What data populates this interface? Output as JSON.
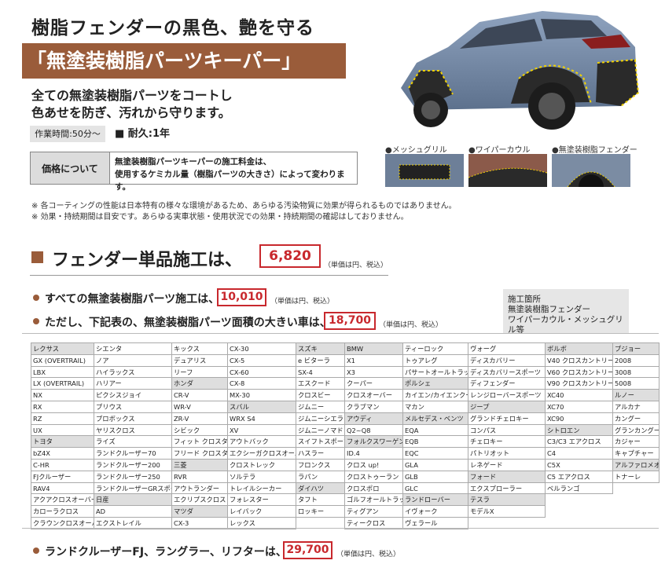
{
  "header": {
    "title1": "樹脂フェンダーの黒色、艶を守る",
    "title2": "「無塗装樹脂パーツキーパー」",
    "desc_line1": "全ての無塗装樹脂パーツをコートし",
    "desc_line2": "色あせを防ぎ、汚れから守ります。",
    "work_time": "作業時間:50分～",
    "durability": "■ 耐久:1年"
  },
  "price_info": {
    "label": "価格について",
    "line1": "無塗装樹脂パーツキーパーの施工料金は、",
    "line2": "使用するケミカル量（樹脂パーツの大きさ）によって変わります。"
  },
  "notes": [
    "※ 各コーティングの性能は日本特有の様々な環境があるため、あらゆる汚染物質に効果が得られるものではありません。",
    "※ 効果・持続期間は目安です。あらゆる実車状態・使用状況での効果・持続期間の確認はしておりません。"
  ],
  "photo_labels": {
    "mesh_grill": "●メッシュグリル",
    "wiper_cowl": "●ワイパーカウル",
    "fender": "●無塗装樹脂フェンダー"
  },
  "fender_single": {
    "label": "フェンダー単品施工は、",
    "price": "6,820",
    "unit": "（単価は円、税込）"
  },
  "all_parts": {
    "label": "すべての無塗装樹脂パーツ施工は、",
    "price": "10,010",
    "unit": "（単価は円、税込）"
  },
  "large_cars": {
    "label": "ただし、下記表の、無塗装樹脂パーツ面積の大きい車は、",
    "price": "18,700",
    "unit": "（単価は円、税込）"
  },
  "info_box": {
    "line1": "施工箇所",
    "line2": "無塗装樹脂フェンダー",
    "line3": "ワイパーカウル・メッシュグリル等"
  },
  "car_table": [
    [
      {
        "t": "レクサス",
        "g": true
      },
      {
        "t": "GX (OVERTRAIL)"
      },
      {
        "t": "LBX"
      },
      {
        "t": "LX (OVERTRAIL)"
      },
      {
        "t": "NX"
      },
      {
        "t": "RX"
      },
      {
        "t": "RZ"
      },
      {
        "t": "UX"
      },
      {
        "t": "トヨタ",
        "g": true
      },
      {
        "t": "bZ4X"
      },
      {
        "t": "C-HR"
      },
      {
        "t": "FJクルーザー"
      },
      {
        "t": "RAV4"
      },
      {
        "t": "アクアクロスオーバー"
      },
      {
        "t": "カローラクロス"
      },
      {
        "t": "クラウンクロスオーバー"
      }
    ],
    [
      {
        "t": "シエンタ"
      },
      {
        "t": "ノア"
      },
      {
        "t": "ハイラックス"
      },
      {
        "t": "ハリアー"
      },
      {
        "t": "ピクシスジョイ"
      },
      {
        "t": "プリウス"
      },
      {
        "t": "プロボックス"
      },
      {
        "t": "ヤリスクロス"
      },
      {
        "t": "ライズ"
      },
      {
        "t": "ランドクルーザー70"
      },
      {
        "t": "ランドクルーザー200"
      },
      {
        "t": "ランドクルーザー250"
      },
      {
        "t": "ランドクルーザーGRスポーツ"
      },
      {
        "t": "日産",
        "g": true
      },
      {
        "t": "AD"
      },
      {
        "t": "エクストレイル"
      }
    ],
    [
      {
        "t": "キックス"
      },
      {
        "t": "デュアリス"
      },
      {
        "t": "リーフ"
      },
      {
        "t": "ホンダ",
        "g": true
      },
      {
        "t": "CR-V"
      },
      {
        "t": "WR-V"
      },
      {
        "t": "ZR-V"
      },
      {
        "t": "シビック"
      },
      {
        "t": "フィット クロスター"
      },
      {
        "t": "フリード クロスター"
      },
      {
        "t": "三菱",
        "g": true
      },
      {
        "t": "RVR"
      },
      {
        "t": "アウトランダー"
      },
      {
        "t": "エクリプスクロス"
      },
      {
        "t": "マツダ",
        "g": true
      },
      {
        "t": "CX-3"
      }
    ],
    [
      {
        "t": "CX-30"
      },
      {
        "t": "CX-5"
      },
      {
        "t": "CX-60"
      },
      {
        "t": "CX-8"
      },
      {
        "t": "MX-30"
      },
      {
        "t": "スバル",
        "g": true
      },
      {
        "t": "WRX S4"
      },
      {
        "t": "XV"
      },
      {
        "t": "アウトバック"
      },
      {
        "t": "エクシーガクロスオーバー"
      },
      {
        "t": "クロストレック"
      },
      {
        "t": "ソルテラ"
      },
      {
        "t": "トレイルシーカー"
      },
      {
        "t": "フォレスター"
      },
      {
        "t": "レイバック"
      },
      {
        "t": "レックス"
      }
    ],
    [
      {
        "t": "スズキ",
        "g": true
      },
      {
        "t": "e ビターラ"
      },
      {
        "t": "SX-4"
      },
      {
        "t": "エスクード"
      },
      {
        "t": "クロスビー"
      },
      {
        "t": "ジムニー"
      },
      {
        "t": "ジムニーシエラ"
      },
      {
        "t": "ジムニーノマド"
      },
      {
        "t": "スイフトスポーツ"
      },
      {
        "t": "ハスラー"
      },
      {
        "t": "フロンクス"
      },
      {
        "t": "ラパン"
      },
      {
        "t": "ダイハツ",
        "g": true
      },
      {
        "t": "タフト"
      },
      {
        "t": "ロッキー"
      }
    ],
    [
      {
        "t": "BMW",
        "g": true
      },
      {
        "t": "X1"
      },
      {
        "t": "X3"
      },
      {
        "t": "クーパー"
      },
      {
        "t": "クロスオーバー"
      },
      {
        "t": "クラブマン"
      },
      {
        "t": "アウディ",
        "g": true
      },
      {
        "t": "Q2~Q8"
      },
      {
        "t": "フォルクスワーゲン",
        "g": true
      },
      {
        "t": "ID.4"
      },
      {
        "t": "クロス up!"
      },
      {
        "t": "クロストゥーラン"
      },
      {
        "t": "クロスポロ"
      },
      {
        "t": "ゴルフオールトラック"
      },
      {
        "t": "ティグアン"
      },
      {
        "t": "ティークロス"
      }
    ],
    [
      {
        "t": "ティーロック"
      },
      {
        "t": "トゥアレグ"
      },
      {
        "t": "パサートオールトラック"
      },
      {
        "t": "ポルシェ",
        "g": true
      },
      {
        "t": "カイエン/カイエンクーペ"
      },
      {
        "t": "マカン"
      },
      {
        "t": "メルセデス・ベンツ",
        "g": true
      },
      {
        "t": "EQA"
      },
      {
        "t": "EQB"
      },
      {
        "t": "EQC"
      },
      {
        "t": "GLA"
      },
      {
        "t": "GLB"
      },
      {
        "t": "GLC"
      },
      {
        "t": "ランドローバー",
        "g": true
      },
      {
        "t": "イヴォーク"
      },
      {
        "t": "ヴェラール"
      }
    ],
    [
      {
        "t": "ヴォーグ"
      },
      {
        "t": "ディスカバリー"
      },
      {
        "t": "ディスカバリースポーツ"
      },
      {
        "t": "ディフェンダー"
      },
      {
        "t": "レンジローバースポーツ"
      },
      {
        "t": "ジープ",
        "g": true
      },
      {
        "t": "グランドチェロキー"
      },
      {
        "t": "コンパス"
      },
      {
        "t": "チェロキー"
      },
      {
        "t": "パトリオット"
      },
      {
        "t": "レネゲード"
      },
      {
        "t": "フォード",
        "g": true
      },
      {
        "t": "エクスプローラー"
      },
      {
        "t": "テスラ",
        "g": true
      },
      {
        "t": "モデルX"
      }
    ],
    [
      {
        "t": "ボルボ",
        "g": true
      },
      {
        "t": "V40 クロスカントリー"
      },
      {
        "t": "V60 クロスカントリー"
      },
      {
        "t": "V90 クロスカントリー"
      },
      {
        "t": "XC40"
      },
      {
        "t": "XC70"
      },
      {
        "t": "XC90"
      },
      {
        "t": "シトロエン",
        "g": true
      },
      {
        "t": "C3/C3 エアクロス"
      },
      {
        "t": "C4"
      },
      {
        "t": "C5X"
      },
      {
        "t": "C5 エアクロス"
      },
      {
        "t": "ベルランゴ"
      }
    ],
    [
      {
        "t": "プジョー",
        "g": true
      },
      {
        "t": "2008"
      },
      {
        "t": "3008"
      },
      {
        "t": "5008"
      },
      {
        "t": "ルノー",
        "g": true
      },
      {
        "t": "アルカナ"
      },
      {
        "t": "カングー"
      },
      {
        "t": "グランカングー"
      },
      {
        "t": "カジャー"
      },
      {
        "t": "キャプチャー"
      },
      {
        "t": "アルファロメオ",
        "g": true
      },
      {
        "t": "トナーレ"
      }
    ]
  ],
  "extra_large": {
    "label": "ランドクルーザーFJ、ラングラー、リフターは、",
    "price": "29,700",
    "unit": "（単価は円、税込）"
  }
}
